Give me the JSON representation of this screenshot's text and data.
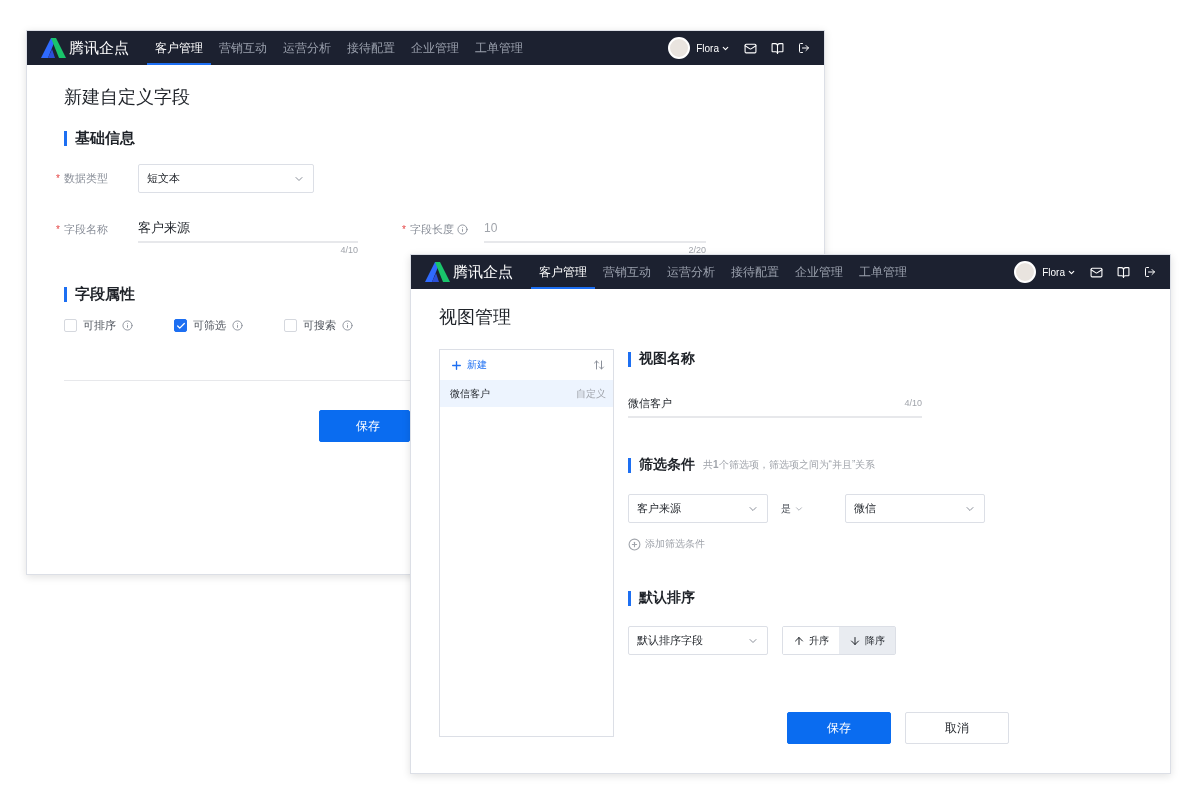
{
  "windows": [
    {
      "kind": "field-editor",
      "nav": {
        "brand": "腾讯企点",
        "user": "Flora",
        "tabs": [
          {
            "label": "客户管理",
            "selected": true
          },
          {
            "label": "营销互动",
            "selected": false
          },
          {
            "label": "运营分析",
            "selected": false
          },
          {
            "label": "接待配置",
            "selected": false
          },
          {
            "label": "企业管理",
            "selected": false
          },
          {
            "label": "工单管理",
            "selected": false
          }
        ]
      },
      "title": "新建自定义字段",
      "basic": {
        "heading": "基础信息",
        "data_type": {
          "mark": "*",
          "label": "数据类型",
          "value": "短文本"
        },
        "name": {
          "mark": "*",
          "label": "字段名称",
          "value": "客户来源",
          "counter": "4/10"
        },
        "length": {
          "mark": "*",
          "label": "字段长度",
          "placeholder": "10",
          "counter": "2/20"
        }
      },
      "attributes": {
        "heading": "字段属性",
        "options": [
          {
            "label": "可排序",
            "checked": false
          },
          {
            "label": "可筛选",
            "checked": true
          },
          {
            "label": "可搜索",
            "checked": false
          }
        ]
      },
      "save": "保存"
    },
    {
      "kind": "view-manager",
      "nav": {
        "brand": "腾讯企点",
        "user": "Flora",
        "tabs": [
          {
            "label": "客户管理",
            "selected": true
          },
          {
            "label": "营销互动",
            "selected": false
          },
          {
            "label": "运营分析",
            "selected": false
          },
          {
            "label": "接待配置",
            "selected": false
          },
          {
            "label": "企业管理",
            "selected": false
          },
          {
            "label": "工单管理",
            "selected": false
          }
        ]
      },
      "title": "视图管理",
      "list": {
        "new": "新建",
        "items": [
          {
            "name": "微信客户",
            "tag": "自定义",
            "selected": true
          }
        ]
      },
      "name_section": {
        "heading": "视图名称",
        "value": "微信客户",
        "counter": "4/10"
      },
      "filter_section": {
        "heading": "筛选条件",
        "hint": "共**1**个筛选项，筛选项之间为“并且”关系",
        "field": "客户来源",
        "operator": "是",
        "value": "微信",
        "add": "添加筛选条件"
      },
      "sort_section": {
        "heading": "默认排序",
        "field": "默认排序字段",
        "orders": [
          {
            "label": "升序",
            "kind": "up",
            "selected": false
          },
          {
            "label": "降序",
            "kind": "down",
            "selected": true
          }
        ]
      },
      "buttons": [
        {
          "label": "保存",
          "kind": "primary"
        },
        {
          "label": "取消",
          "kind": "secondary"
        }
      ]
    }
  ]
}
